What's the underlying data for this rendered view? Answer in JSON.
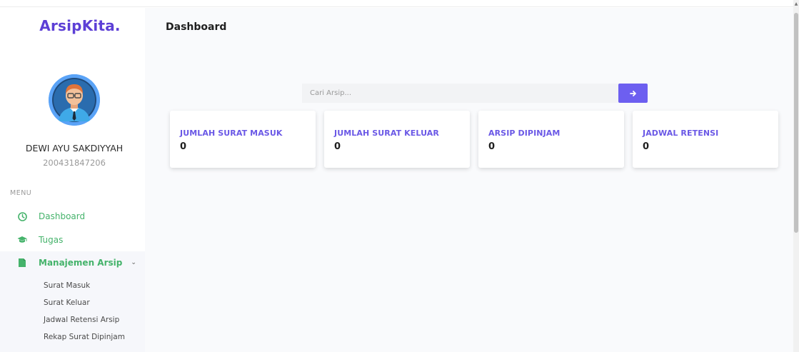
{
  "brand": {
    "name": "ArsipKita."
  },
  "user": {
    "name": "DEWI AYU SAKDIYYAH",
    "id": "200431847206"
  },
  "menu": {
    "heading": "MENU",
    "items": [
      {
        "label": "Dashboard",
        "icon": "dashboard-icon"
      },
      {
        "label": "Tugas",
        "icon": "graduation-cap-icon"
      },
      {
        "label": "Manajemen Arsip",
        "icon": "file-icon",
        "expanded": true
      }
    ],
    "submenu": [
      {
        "label": "Surat Masuk"
      },
      {
        "label": "Surat Keluar"
      },
      {
        "label": "Jadwal Retensi Arsip"
      },
      {
        "label": "Rekap Surat Dipinjam"
      }
    ]
  },
  "page": {
    "title": "Dashboard"
  },
  "search": {
    "placeholder": "Cari Arsip...",
    "value": ""
  },
  "cards": [
    {
      "title": "JUMLAH SURAT MASUK",
      "value": "0"
    },
    {
      "title": "JUMLAH SURAT KELUAR",
      "value": "0"
    },
    {
      "title": "ARSIP DIPINJAM",
      "value": "0"
    },
    {
      "title": "JADWAL RETENSI",
      "value": "0"
    }
  ],
  "colors": {
    "brand": "#5c3fd6",
    "accent": "#6d5ff0",
    "menu_green": "#45b36b",
    "card_title": "#6a58e6"
  }
}
